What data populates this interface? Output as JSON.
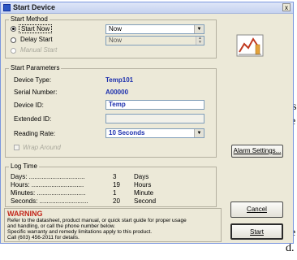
{
  "background_left_text": [
    "s",
    "e",
    ".",
    "e",
    "d."
  ],
  "window": {
    "title": "Start Device",
    "close_glyph": "x"
  },
  "start_method": {
    "title": "Start Method",
    "options": [
      {
        "label": "Start Now",
        "selected": true,
        "enabled": true,
        "field_value": "Now"
      },
      {
        "label": "Delay Start",
        "selected": false,
        "enabled": true,
        "field_value": "Now"
      },
      {
        "label": "Manual Start",
        "selected": false,
        "enabled": false
      }
    ]
  },
  "params": {
    "title": "Start Parameters",
    "device_type_label": "Device Type:",
    "device_type_value": "Temp101",
    "serial_label": "Serial Number:",
    "serial_value": "A00000",
    "device_id_label": "Device ID:",
    "device_id_value": "Temp",
    "extended_id_label": "Extended ID:",
    "extended_id_value": "",
    "reading_rate_label": "Reading Rate:",
    "reading_rate_value": "10 Seconds",
    "wrap_label": "Wrap Around"
  },
  "alarm_button": "Alarm Settings...",
  "log_time": {
    "title": "Log Time",
    "rows": [
      {
        "label": "Days: ...............................",
        "value": "3",
        "unit": "Days"
      },
      {
        "label": "Hours: .............................",
        "value": "19",
        "unit": "Hours"
      },
      {
        "label": "Minutes: ...........................",
        "value": "1",
        "unit": "Minute"
      },
      {
        "label": "Seconds: ...........................",
        "value": "20",
        "unit": "Second"
      }
    ]
  },
  "warning": {
    "title": "WARNING",
    "lines": [
      "Refer to the datasheet, product manual, or quick start guide for proper usage",
      "and handling, or call the phone number below.",
      "Specific warranty and remedy limitations apply to this product.",
      "Call (603) 456-2011 for details."
    ]
  },
  "cancel_button": "Cancel",
  "start_button": "Start",
  "colors": {
    "accent": "#1c2fae",
    "warning": "#c2271b",
    "dialog_bg": "#ece9d8"
  }
}
